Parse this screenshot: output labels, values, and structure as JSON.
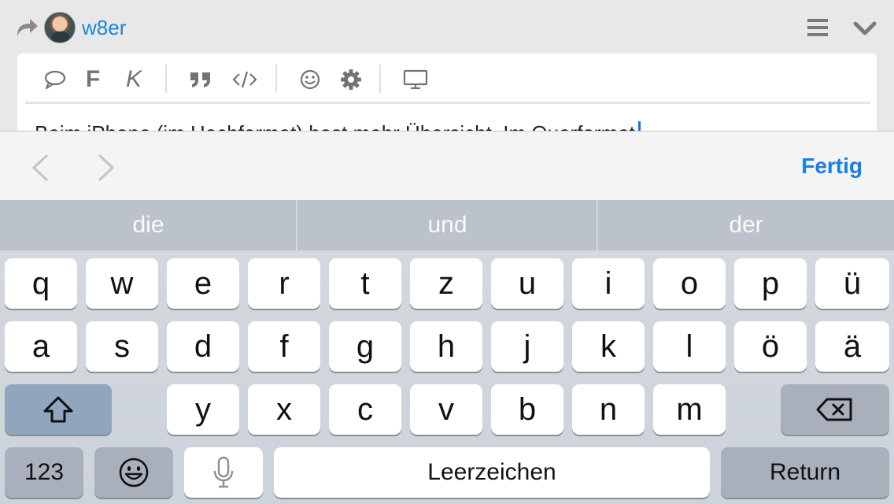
{
  "header": {
    "username": "w8er",
    "icons": [
      "reply-arrow-icon",
      "avatar",
      "menu-icon",
      "chevron-down-icon"
    ]
  },
  "toolbar": {
    "bold_label": "F",
    "italic_label": "K",
    "icons": [
      "comment-icon",
      "bold-icon",
      "italic-icon",
      "quote-icon",
      "code-icon",
      "emoji-icon",
      "gear-icon",
      "preview-icon"
    ]
  },
  "editor": {
    "text": "Beim iPhone (im Hochformat) hast mehr Übersicht. Im Querformat"
  },
  "accessory": {
    "done_label": "Fertig",
    "icons": [
      "chevron-left-icon",
      "chevron-right-icon"
    ]
  },
  "predictive": {
    "suggestions": [
      "die",
      "und",
      "der"
    ]
  },
  "keyboard": {
    "row1": [
      "q",
      "w",
      "e",
      "r",
      "t",
      "z",
      "u",
      "i",
      "o",
      "p",
      "ü"
    ],
    "row2": [
      "a",
      "s",
      "d",
      "f",
      "g",
      "h",
      "j",
      "k",
      "l",
      "ö",
      "ä"
    ],
    "row3": [
      "y",
      "x",
      "c",
      "v",
      "b",
      "n",
      "m"
    ],
    "numbers_label": "123",
    "space_label": "Leerzeichen",
    "return_label": "Return",
    "icons": [
      "shift-icon",
      "delete-icon",
      "emoji-keyboard-icon",
      "microphone-icon"
    ]
  },
  "colors": {
    "accent": "#1a7fe3",
    "username": "#1a87d9",
    "caret": "#1a6fe0",
    "keyboard_bg": "#d3d8de",
    "key_bg": "#ffffff",
    "dark_key_bg": "#a9b0bb",
    "predictive_bg": "#bcc2cb"
  }
}
